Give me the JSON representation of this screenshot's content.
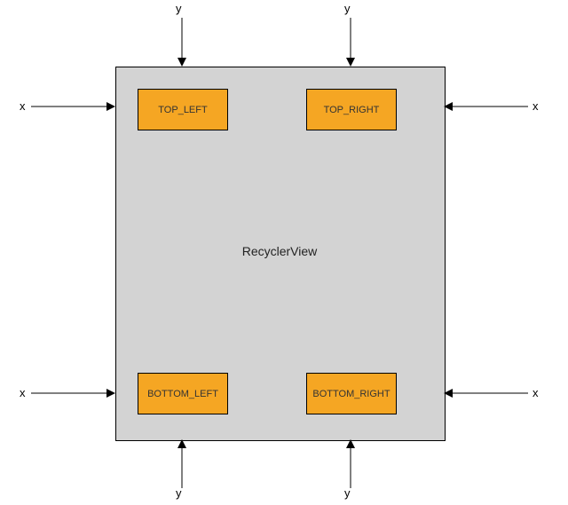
{
  "container": {
    "label": "RecyclerView"
  },
  "boxes": {
    "top_left": "TOP_LEFT",
    "top_right": "TOP_RIGHT",
    "bottom_left": "BOTTOM_LEFT",
    "bottom_right": "BOTTOM_RIGHT"
  },
  "axis_labels": {
    "top_left_y": "y",
    "top_right_y": "y",
    "bottom_left_y": "y",
    "bottom_right_y": "y",
    "left_top_x": "x",
    "left_bottom_x": "x",
    "right_top_x": "x",
    "right_bottom_x": "x"
  },
  "colors": {
    "container_fill": "#d3d3d3",
    "box_fill": "#f5a623",
    "stroke": "#000000"
  }
}
